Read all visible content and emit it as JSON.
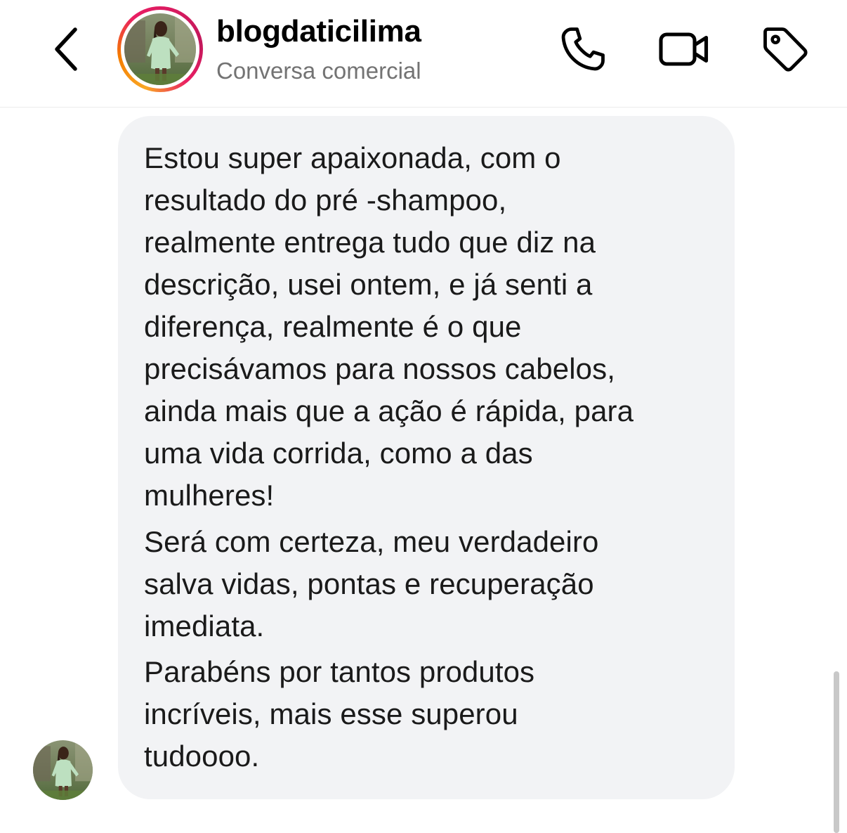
{
  "header": {
    "username": "blogdaticilima",
    "subtitle": "Conversa comercial",
    "icons": {
      "back": "chevron-left-icon",
      "call": "phone-icon",
      "video": "video-camera-icon",
      "label": "tag-icon"
    },
    "story_ring_colors": [
      "#f9a825",
      "#e91e63",
      "#c2185b"
    ]
  },
  "message": {
    "paragraphs": [
      "Estou super apaixonada, com o\nresultado do pré -shampoo,\nrealmente entrega tudo que diz na\ndescrição, usei ontem, e já senti a\ndiferença, realmente é o que\nprecisávamos para nossos cabelos,\nainda mais que a ação é rápida, para\numa vida corrida, como a das\nmulheres!",
      "Será com certeza, meu verdadeiro\nsalva vidas, pontas e recuperação\nimediata.",
      "Parabéns por tantos produtos\nincríveis, mais esse superou\ntudoooo."
    ],
    "bubble_color": "#f2f3f5"
  }
}
